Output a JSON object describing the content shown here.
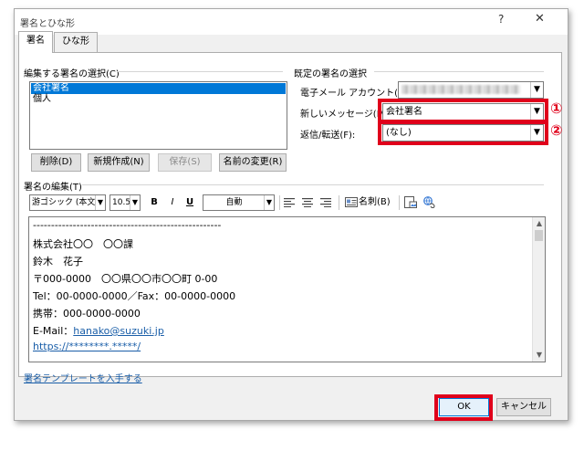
{
  "window": {
    "title": "署名とひな形",
    "help_icon": "?",
    "close_icon": "✕"
  },
  "tabs": [
    {
      "label": "署名",
      "active": true
    },
    {
      "label": "ひな形",
      "active": false
    }
  ],
  "select_section": {
    "label": "編集する署名の選択(C)",
    "items": [
      "会社署名",
      "個人"
    ],
    "selected": "会社署名"
  },
  "buttons": {
    "delete": "削除(D)",
    "new": "新規作成(N)",
    "save": "保存(S)",
    "rename": "名前の変更(R)"
  },
  "defaults_section": {
    "label": "既定の署名の選択",
    "email_account_label": "電子メール アカウント(A):",
    "new_messages_label": "新しいメッセージ(M):",
    "new_messages_value": "会社署名",
    "reply_forward_label": "返信/転送(F):",
    "reply_forward_value": "(なし)"
  },
  "annotations": {
    "circle_1": "①",
    "circle_2": "②",
    "highlight_color": "#e0001b"
  },
  "edit_section": {
    "label": "署名の編集(T)",
    "font_value": "游ゴシック (本文の",
    "size_value": "10.5",
    "bold": "B",
    "italic": "I",
    "underline": "U",
    "color_value": "自動",
    "business_card": "名刺(B)"
  },
  "signature": {
    "divider": "----------------------------------------------------",
    "company": "株式会社〇〇　〇〇課",
    "name": "鈴木　花子",
    "address": "〒000-0000　〇〇県〇〇市〇〇町 0-00",
    "tel_fax": "Tel：00-0000-0000／Fax：00-0000-0000",
    "mobile": "携帯：000-0000-0000",
    "email_prefix": "E-Mail：",
    "email_link": "hanako@suzuki.jp",
    "url": "https://********.*****/"
  },
  "template_link": "署名テンプレートを入手する",
  "footer": {
    "ok": "OK",
    "cancel": "キャンセル"
  }
}
